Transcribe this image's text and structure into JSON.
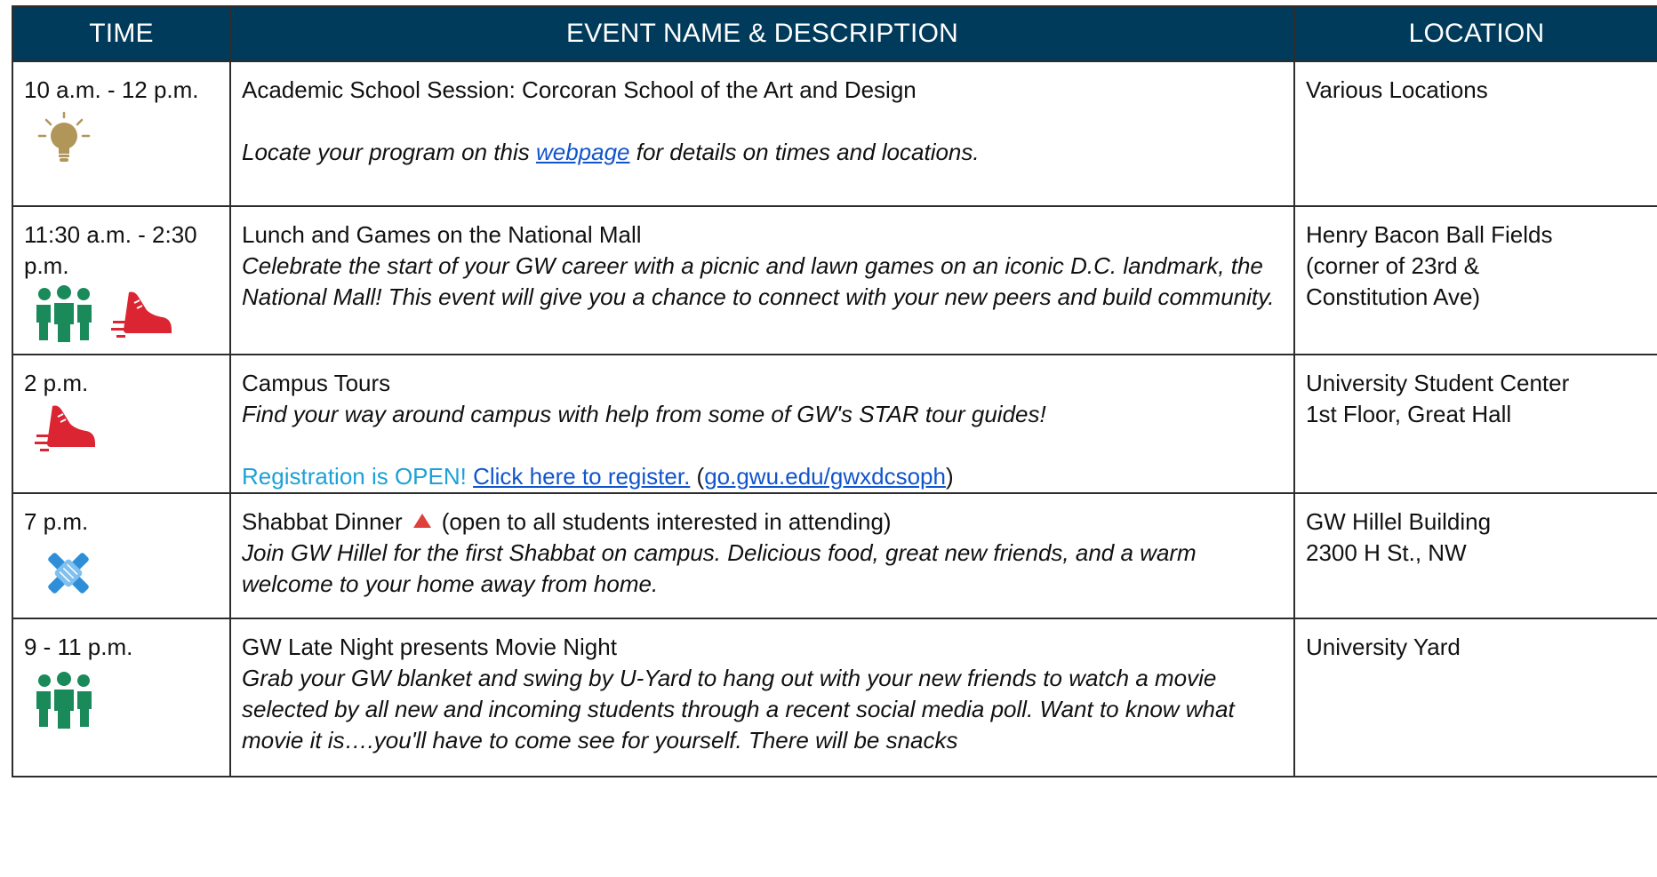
{
  "header": {
    "time": "TIME",
    "event": "EVENT NAME & DESCRIPTION",
    "location": "LOCATION"
  },
  "rows": [
    {
      "time": "10 a.m. - 12 p.m.",
      "title": "Academic School Session: Corcoran School of the Art and Design",
      "desc_before": "Locate your program on this ",
      "desc_link": "webpage",
      "desc_after": " for details on times and locations.",
      "location": "Various Locations",
      "icons": [
        "lightbulb-icon"
      ]
    },
    {
      "time": "11:30 a.m. - 2:30 p.m.",
      "title": "Lunch and Games on the National Mall",
      "desc": "Celebrate the start of your GW career with a picnic and lawn games on an iconic D.C. landmark, the National Mall! This event will give you a chance to connect with your new peers and build community.",
      "location": "Henry Bacon Ball Fields (corner of 23rd & Constitution Ave)",
      "icons": [
        "group-people-icon",
        "running-shoe-icon"
      ]
    },
    {
      "time": "2 p.m.",
      "title": "Campus Tours",
      "desc": "Find your way around campus with help from some of GW's STAR tour guides!",
      "reg_text": "Registration is OPEN! ",
      "reg_link": "Click here to register.",
      "reg_paren_open": " (",
      "reg_url": "go.gwu.edu/gwxdcsoph",
      "reg_paren_close": ")",
      "location_line1": "University Student Center",
      "location_line2": "1st Floor, Great Hall",
      "icons": [
        "running-shoe-icon"
      ]
    },
    {
      "time": "7 p.m.",
      "title": "Shabbat Dinner",
      "title_suffix": "(open to all students interested in attending)",
      "desc": "Join GW Hillel for the first Shabbat on campus. Delicious food, great new friends, and a warm welcome to your home away from home.",
      "location_line1": "GW Hillel Building",
      "location_line2": "2300 H St., NW",
      "icons": [
        "triangle-marker-icon",
        "hands-together-icon"
      ]
    },
    {
      "time": "9 - 11 p.m.",
      "title": "GW Late Night presents Movie Night",
      "desc": "Grab your GW blanket and swing by U-Yard to hang out with your new friends to watch a movie selected by all new and incoming students through a recent social media poll. Want to know what movie it is….you'll have to come see for yourself. There will be snacks",
      "location": "University Yard",
      "icons": [
        "group-people-icon"
      ]
    }
  ],
  "colors": {
    "header_bg": "#003b5c",
    "link": "#1155cc",
    "registration": "#1da1d6",
    "lightbulb": "#b1965a",
    "people": "#1a8a5a",
    "shoe": "#dc2532",
    "hands": "#2f8ed8",
    "triangle": "#e0403a"
  }
}
